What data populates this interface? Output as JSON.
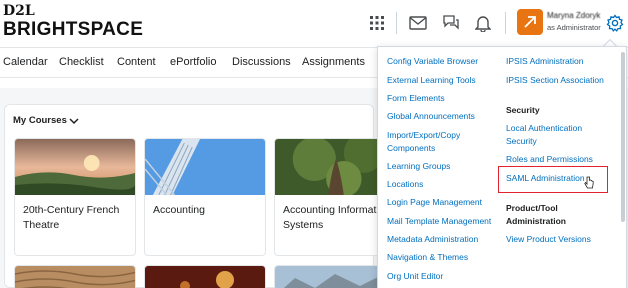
{
  "header": {
    "logo_top": "D2L",
    "logo_main": "BRIGHTSPACE",
    "icons": [
      "waffle-icon",
      "mail-icon",
      "chat-icon",
      "bell-icon"
    ],
    "user_name": "Maryna Zdoryk",
    "user_role": "as Administrator",
    "accent_color": "#e87511"
  },
  "nav": {
    "items": [
      "Calendar",
      "Checklist",
      "Content",
      "ePortfolio",
      "Discussions",
      "Assignments"
    ]
  },
  "main": {
    "my_courses_label": "My Courses",
    "courses": [
      {
        "title": "20th-Century French Theatre"
      },
      {
        "title": "Accounting"
      },
      {
        "title": "Accounting Information Systems"
      }
    ]
  },
  "admin_menu": {
    "col1": [
      "Config Variable Browser",
      "External Learning Tools",
      "Form Elements",
      "Global Announcements",
      "Import/Export/Copy Components",
      "Learning Groups",
      "Locations",
      "Login Page Management",
      "Mail Template Management",
      "Metadata Administration",
      "Navigation & Themes",
      "Org Unit Editor"
    ],
    "col2_top": [
      "IPSIS Administration",
      "IPSIS Section Association"
    ],
    "security_heading": "Security",
    "security_items": [
      "Local Authentication Security",
      "Roles and Permissions",
      "SAML Administration"
    ],
    "product_heading": "Product/Tool Administration",
    "product_items": [
      "View Product Versions"
    ],
    "highlight_color": "#e0232e",
    "link_color": "#006fbf"
  }
}
